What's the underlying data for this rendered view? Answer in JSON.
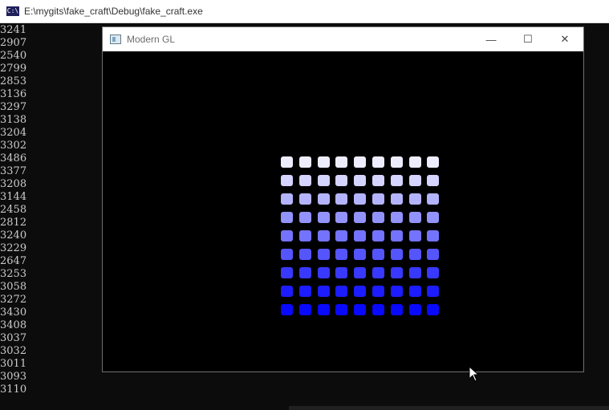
{
  "console": {
    "title": "E:\\mygits\\fake_craft\\Debug\\fake_craft.exe",
    "icon": "console-icon",
    "icon_text": "C:\\",
    "lines": [
      "3241",
      "2907",
      "2540",
      "2799",
      "2853",
      "3136",
      "3297",
      "3138",
      "3204",
      "3302",
      "3486",
      "3377",
      "3208",
      "3144",
      "2458",
      "2812",
      "3240",
      "3229",
      "2647",
      "3253",
      "3058",
      "3272",
      "3430",
      "3408",
      "3037",
      "3032",
      "3011",
      "3093",
      "3110"
    ]
  },
  "gl_window": {
    "title": "Modern GL",
    "icon": "app-window-icon",
    "buttons": {
      "minimize": "—",
      "maximize": "☐",
      "close": "✕"
    },
    "grid": {
      "rows": 9,
      "columns": 9,
      "row_colors": [
        "#ededfe",
        "#d4d4fe",
        "#b4b4fe",
        "#9393fe",
        "#7373fe",
        "#5555fe",
        "#3838fe",
        "#1c1cfe",
        "#0909fe"
      ]
    }
  },
  "colors": {
    "console_background": "#0c0c0c",
    "console_text": "#cccccc",
    "viewport_background": "#000000"
  }
}
